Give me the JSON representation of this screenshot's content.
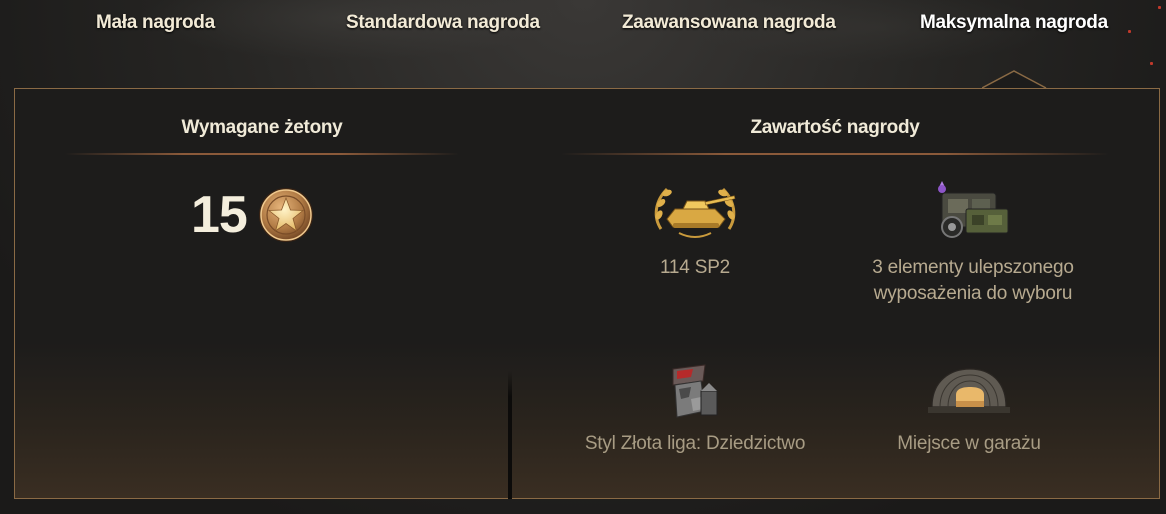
{
  "tabs": [
    {
      "label": "Mała nagroda",
      "active": false
    },
    {
      "label": "Standardowa nagroda",
      "active": false
    },
    {
      "label": "Zaawansowana nagroda",
      "active": false
    },
    {
      "label": "Maksymalna nagroda",
      "active": true
    }
  ],
  "requirements": {
    "title": "Wymagane żetony",
    "token_count": "15",
    "token_icon": "star-token-icon"
  },
  "contents": {
    "title": "Zawartość nagrody",
    "items": [
      {
        "label": "114 SP2",
        "icon": "gold-tank-laurel-icon"
      },
      {
        "label_line1": "3 elementy ulepszonego",
        "label_line2": "wyposażenia do wyboru",
        "icon": "equipment-crate-icon"
      },
      {
        "label": "Styl Złota liga: Dziedzictwo",
        "icon": "camouflage-style-icon"
      },
      {
        "label": "Miejsce w garażu",
        "icon": "garage-hangar-icon"
      }
    ]
  },
  "colors": {
    "accent_border": "#8a6a45",
    "title_text": "#f0ead8",
    "item_text": "#b7aa90"
  }
}
